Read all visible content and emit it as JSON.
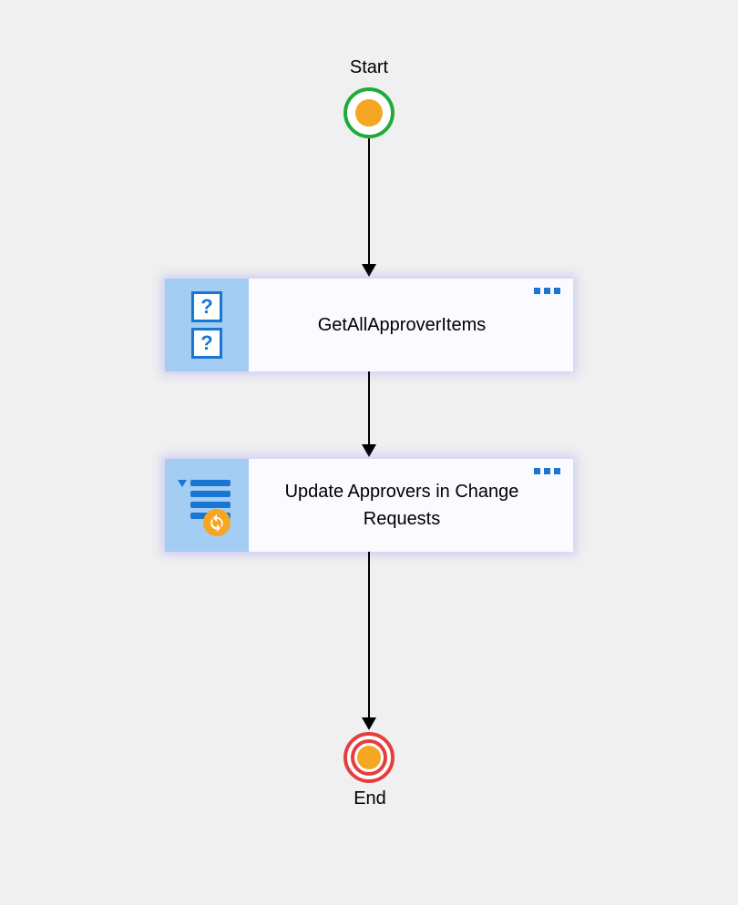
{
  "start": {
    "label": "Start"
  },
  "end": {
    "label": "End"
  },
  "nodes": {
    "n1": {
      "title": "GetAllApproverItems",
      "icon": "query-boxes"
    },
    "n2": {
      "title": "Update Approvers in Change Requests",
      "icon": "list-refresh"
    }
  },
  "layout": {
    "centerX": 405,
    "startY": 100,
    "n1Y": 306,
    "n2Y": 504,
    "endY": 804
  }
}
